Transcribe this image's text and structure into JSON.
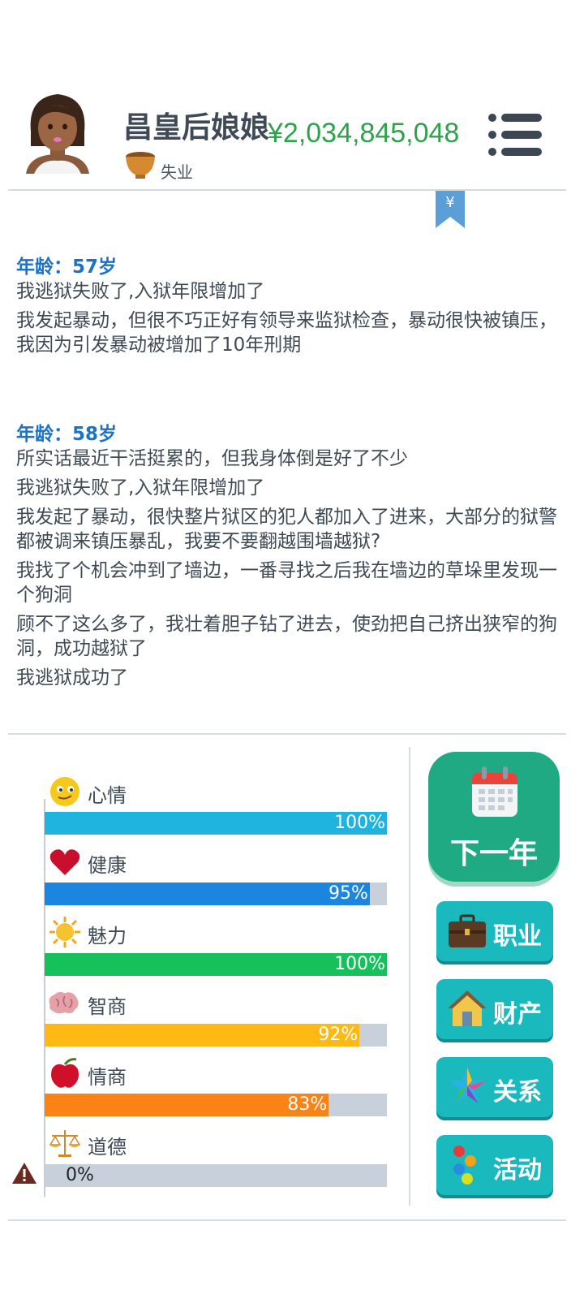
{
  "header": {
    "name": "昌皇后娘娘",
    "money": "¥2,034,845,048",
    "job": "失业",
    "money_color": "#2fa24c"
  },
  "bookmark": {
    "symbol": "¥"
  },
  "log": [
    {
      "age": "年龄：57岁",
      "entries": [
        "我逃狱失败了,入狱年限增加了",
        "我发起暴动，但很不巧正好有领导来监狱检查，暴动很快被镇压，我因为引发暴动被增加了10年刑期"
      ]
    },
    {
      "age": "年龄：58岁",
      "entries": [
        "所实话最近干活挺累的，但我身体倒是好了不少",
        "我逃狱失败了,入狱年限增加了",
        "我发起了暴动，很快整片狱区的犯人都加入了进来，大部分的狱警都被调来镇压暴乱，我要不要翻越围墙越狱?",
        "我找了个机会冲到了墙边，一番寻找之后我在墙边的草垛里发现一个狗洞",
        "顾不了这么多了，我壮着胆子钻了进去，使劲把自己挤出狭窄的狗洞，成功越狱了",
        "我逃狱成功了"
      ]
    }
  ],
  "stats": [
    {
      "label": "心情",
      "icon": "smiley-icon",
      "value": 1.0,
      "pct": "100%",
      "color": "#1fb3e0"
    },
    {
      "label": "健康",
      "icon": "heart-icon",
      "value": 0.95,
      "pct": "95%",
      "color": "#1a86e0"
    },
    {
      "label": "魅力",
      "icon": "sun-icon",
      "value": 1.0,
      "pct": "100%",
      "color": "#16c05a"
    },
    {
      "label": "智商",
      "icon": "brain-icon",
      "value": 0.92,
      "pct": "92%",
      "color": "#ffb915"
    },
    {
      "label": "情商",
      "icon": "apple-icon",
      "value": 0.83,
      "pct": "83%",
      "color": "#fb8214"
    },
    {
      "label": "道德",
      "icon": "scale-icon",
      "value": 0.0,
      "pct": "0%",
      "color": "#c8d1db"
    }
  ],
  "buttons": {
    "next_year": "下一年",
    "career": "职业",
    "assets": "财产",
    "relations": "关系",
    "activities": "活动"
  }
}
